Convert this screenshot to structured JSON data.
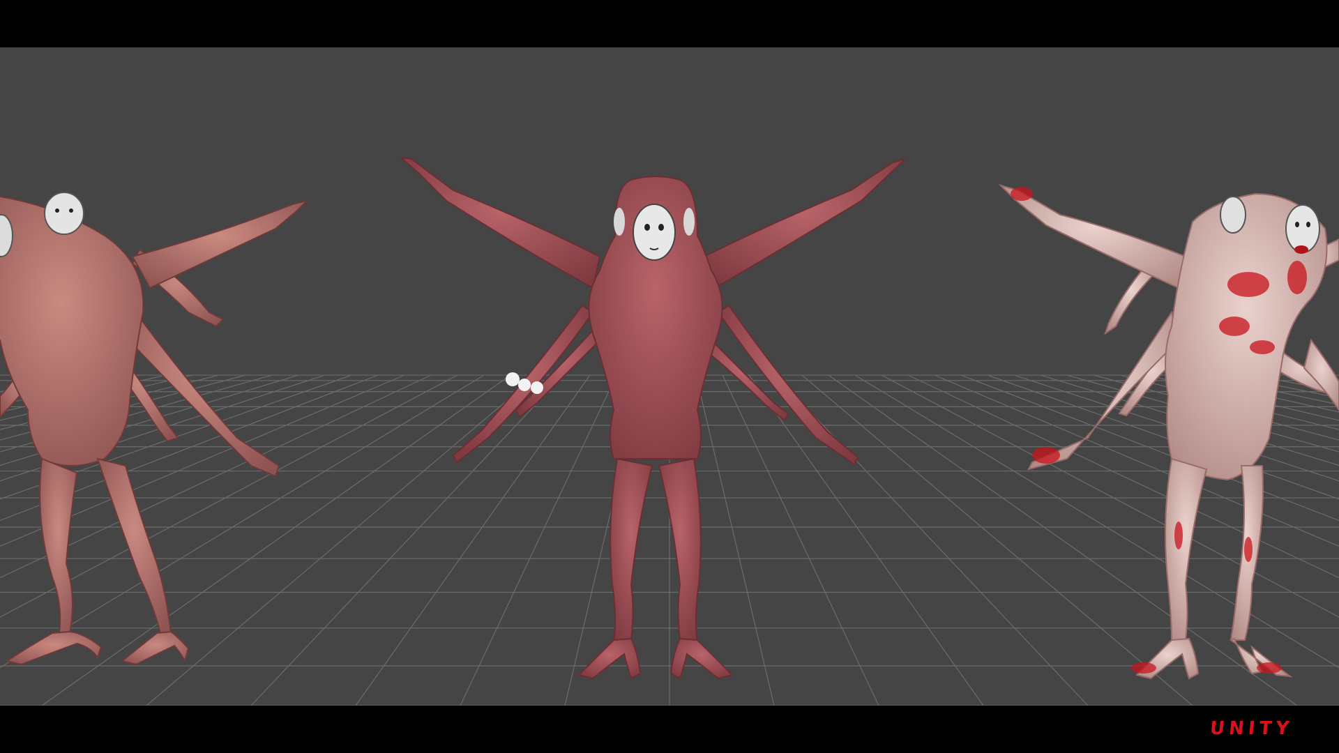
{
  "branding": {
    "engine_logo": "UNITY",
    "logo_color": "#d8121a"
  },
  "scene": {
    "background_color": "#454545",
    "grid_color": "#8a8a8a",
    "models": [
      {
        "id": "variant-left",
        "skin_color": "#b8706e",
        "mask_color": "#e4e4e4",
        "blood": false
      },
      {
        "id": "variant-center",
        "skin_color": "#a85356",
        "mask_color": "#e8e8e8",
        "blood": false
      },
      {
        "id": "variant-right",
        "skin_color": "#d8b2ac",
        "mask_color": "#e6e6e6",
        "blood": true
      }
    ]
  }
}
